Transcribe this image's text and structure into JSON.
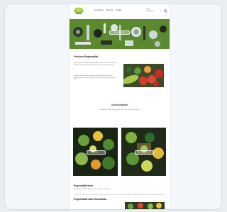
{
  "header": {
    "nav": [
      "Gemüsebox",
      "Über uns",
      "Kontakt"
    ],
    "right_lines": [
      "Login",
      "Warenkorb"
    ]
  },
  "hero": {
    "button_label": "Jetzt entdecken"
  },
  "intro": {
    "title": "Frisches Regionalität",
    "text": "Frisches Gemüse aus der Region, direkt vom Hof zu Ihnen nach Hause geliefert. Saisonal, nachhaltig und voller Geschmack für jeden Tag."
  },
  "offers": {
    "title": "Unser Angebot",
    "text": "Wählen Sie Ihre Box und genießen Sie frische Zutaten jede Woche."
  },
  "cards": [
    {
      "button_label": "Zur Box"
    },
    {
      "button_label": "Zur Box"
    }
  ],
  "bottom": {
    "title": "Regionalität leben",
    "text": "Wir arbeiten mit Bauernhöfen aus der Umgebung zusammen.",
    "title2": "Regionalität dank Bio-Anbau",
    "title2_line2": "Bio-Anbau"
  },
  "colors": {
    "accent": "#5b8a2e",
    "background": "#f3f6fa"
  }
}
